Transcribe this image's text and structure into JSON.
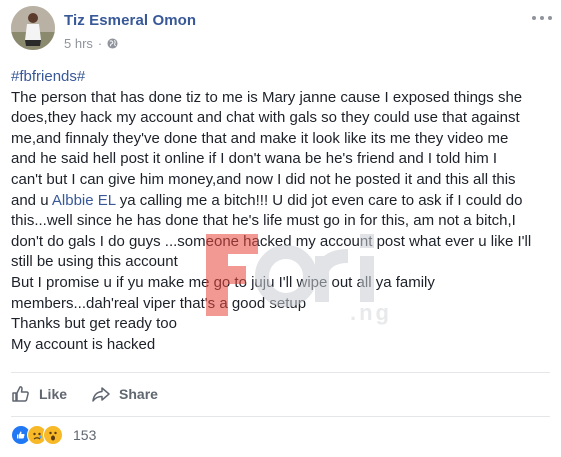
{
  "post": {
    "author": "Tiz Esmeral Omon",
    "time": "5 hrs",
    "privacy_icon": "globe-icon",
    "lines": [
      {
        "text": "#fbfriends#",
        "style": "link"
      },
      {
        "text": "The person that has done tiz to me is Mary janne cause I exposed things she"
      },
      {
        "text": "does,they hack my account and chat with gals so they could use that against"
      },
      {
        "text": "me,and finnaly they've done that and make it look like its me they video me"
      },
      {
        "text": "and he said hell post it online if I don't wana be he's friend and I told him I"
      },
      {
        "text": "can't but I can give him money,and now I did not he posted it and this all this"
      },
      {
        "pre": "and u ",
        "link": "Albbie EL",
        "post": " ya calling me a bitch!!! U did jot even care to ask if I could do"
      },
      {
        "text": "this...well since he has done that he's life must go in for this, am not a bitch,I"
      },
      {
        "text": "don't do gals I do guys ...someone hacked my account post what ever u like I'll"
      },
      {
        "text": "still be using this account"
      },
      {
        "text": "But I promise u if yu make me go to juju I'll wipe out all ya family"
      },
      {
        "text": "members...dah'real viper that's a good setup"
      },
      {
        "text": "Thanks but get ready too"
      },
      {
        "text": "My account is hacked"
      }
    ]
  },
  "watermark": {
    "brand": "ori",
    "domain": ".ng"
  },
  "actions": {
    "like_label": "Like",
    "share_label": "Share"
  },
  "reactions": {
    "types": [
      "like",
      "sad",
      "wow"
    ],
    "count": "153"
  },
  "colors": {
    "link": "#385898",
    "text": "#1d2129",
    "muted": "#90949c",
    "like_blue": "#2078f4",
    "reaction_yellow": "#f7b928",
    "watermark_red": "#e8463b"
  }
}
